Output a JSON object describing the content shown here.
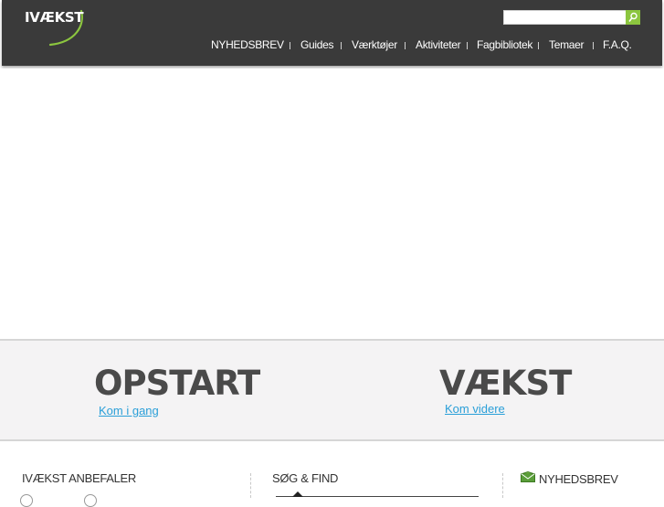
{
  "brand": {
    "name": "IVÆKST",
    "accent": "#8cc63f"
  },
  "search": {
    "placeholder": "",
    "value": "",
    "button_icon": "search-icon"
  },
  "nav": {
    "items": [
      {
        "label": "NYHEDSBREV"
      },
      {
        "label": "Guides"
      },
      {
        "label": "Værktøjer"
      },
      {
        "label": "Aktiviteter"
      },
      {
        "label": "Fagbibliotek"
      },
      {
        "label": "Temaer"
      },
      {
        "label": "F.A.Q."
      }
    ]
  },
  "band": {
    "left": {
      "title": "OPSTART",
      "link": "Kom i gang"
    },
    "right": {
      "title": "VÆKST",
      "link": "Kom videre"
    }
  },
  "footer": {
    "col1_title": "IVÆKST ANBEFALER",
    "col2_title": "SØG & FIND",
    "col3_title": "NYHEDSBREV",
    "col3_icon": "envelope-icon"
  },
  "colors": {
    "header_bg": "#3a3a3a",
    "link": "#2a9fd8",
    "band_bg": "#f4f3f4"
  }
}
